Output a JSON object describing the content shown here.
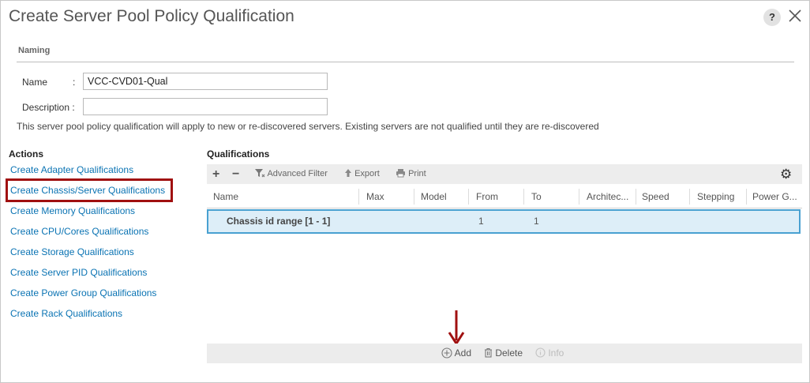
{
  "dialog": {
    "title": "Create Server Pool Policy Qualification",
    "help_label": "?",
    "close_icon": "close-icon"
  },
  "naming": {
    "section_label": "Naming",
    "name_label": "Name",
    "name_value": "VCC-CVD01-Qual",
    "description_label": "Description :",
    "description_value": "",
    "colon": ":",
    "note": "This server pool policy qualification will apply to new or re-discovered servers. Existing servers are not qualified until they are re-discovered"
  },
  "actions": {
    "heading": "Actions",
    "items": [
      {
        "label": "Create Adapter Qualifications"
      },
      {
        "label": "Create Chassis/Server Qualifications"
      },
      {
        "label": "Create Memory Qualifications"
      },
      {
        "label": "Create CPU/Cores Qualifications"
      },
      {
        "label": "Create Storage Qualifications"
      },
      {
        "label": "Create Server PID Qualifications"
      },
      {
        "label": "Create Power Group Qualifications"
      },
      {
        "label": "Create Rack Qualifications"
      }
    ],
    "highlighted_index": 1
  },
  "qualifications": {
    "heading": "Qualifications",
    "toolbar": {
      "add_symbol": "+",
      "remove_symbol": "−",
      "filter_label": "Advanced Filter",
      "export_label": "Export",
      "print_label": "Print"
    },
    "columns": [
      "Name",
      "Max",
      "Model",
      "From",
      "To",
      "Architec...",
      "Speed",
      "Stepping",
      "Power G..."
    ],
    "rows": [
      {
        "name": "Chassis id range [1 - 1]",
        "max": "",
        "model": "",
        "from": "1",
        "to": "1",
        "architecture": "",
        "speed": "",
        "stepping": "",
        "power_group": ""
      }
    ],
    "bottom_actions": {
      "add_label": "Add",
      "delete_label": "Delete",
      "info_label": "Info"
    }
  },
  "colors": {
    "link": "#0a73b3",
    "highlight_border": "#a01010",
    "selected_row_bg": "#ddeef8",
    "selected_row_border": "#49a1d1"
  }
}
